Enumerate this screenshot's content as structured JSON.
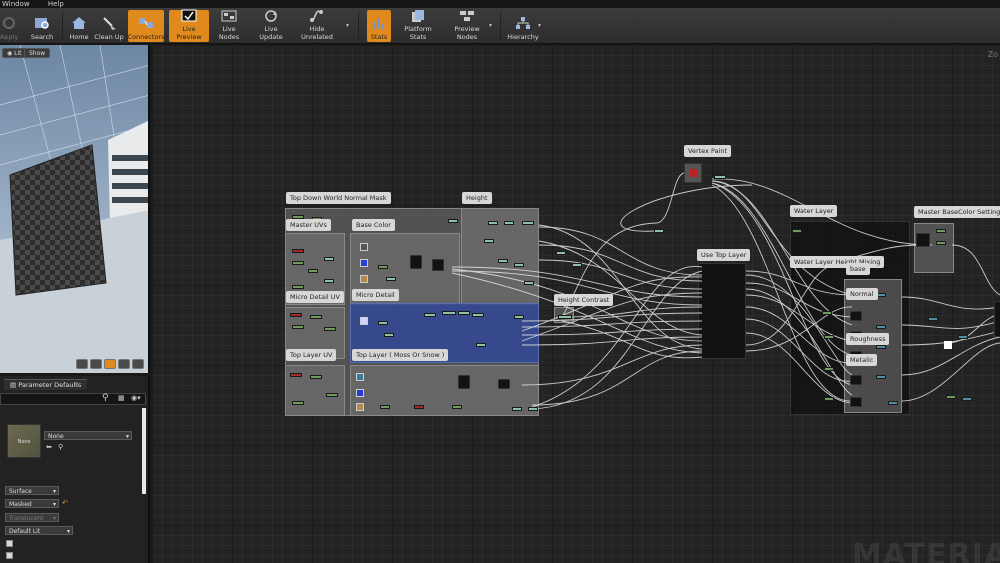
{
  "menu": {
    "window": "Window",
    "help": "Help"
  },
  "toolbar": {
    "apply": "Apply",
    "search": "Search",
    "home": "Home",
    "clean_up": "Clean Up",
    "connectors": "Connectors",
    "live_preview": "Live Preview",
    "live_nodes": "Live Nodes",
    "live_update": "Live Update",
    "hide_unrelated": "Hide Unrelated",
    "stats": "Stats",
    "platform_stats": "Platform Stats",
    "preview_nodes": "Preview Nodes",
    "hierarchy": "Hierarchy"
  },
  "viewport": {
    "lit": "Lit",
    "show": "Show"
  },
  "details": {
    "tab": "Parameter Defaults",
    "texture_value": "None",
    "thumb_label": "None",
    "material_domain": "Surface",
    "blend_mode": "Masked",
    "translucent": "Translucent",
    "shading_model": "Default Lit"
  },
  "graph": {
    "zoom_label": "Zo",
    "watermark": "MATERIA",
    "comments": {
      "top_down": "Top Down World Normal Mask",
      "height": "Height",
      "master_uvs": "Master UVs",
      "base_color": "Base Color",
      "micro_detail_uv": "Micro Detail UV",
      "micro_detail": "Micro Detail",
      "top_layer_uv": "Top Layer UV",
      "top_layer": "Top Layer ( Moss Or Snow )",
      "height_contrast": "Height Contrast",
      "vertex_paint": "Vertex Paint",
      "use_top_layer": "Use Top Layer",
      "water_layer": "Water Layer",
      "water_layer_height_mixing": "Water Layer Height Mixing",
      "base": "base",
      "normal": "Normal",
      "roughness": "Roughness",
      "metalic": "Metalic",
      "master_basecolor": "Master BaseColor Settings"
    }
  },
  "colors": {
    "accent": "#e08a1e",
    "blue_comment": "#30489a"
  }
}
